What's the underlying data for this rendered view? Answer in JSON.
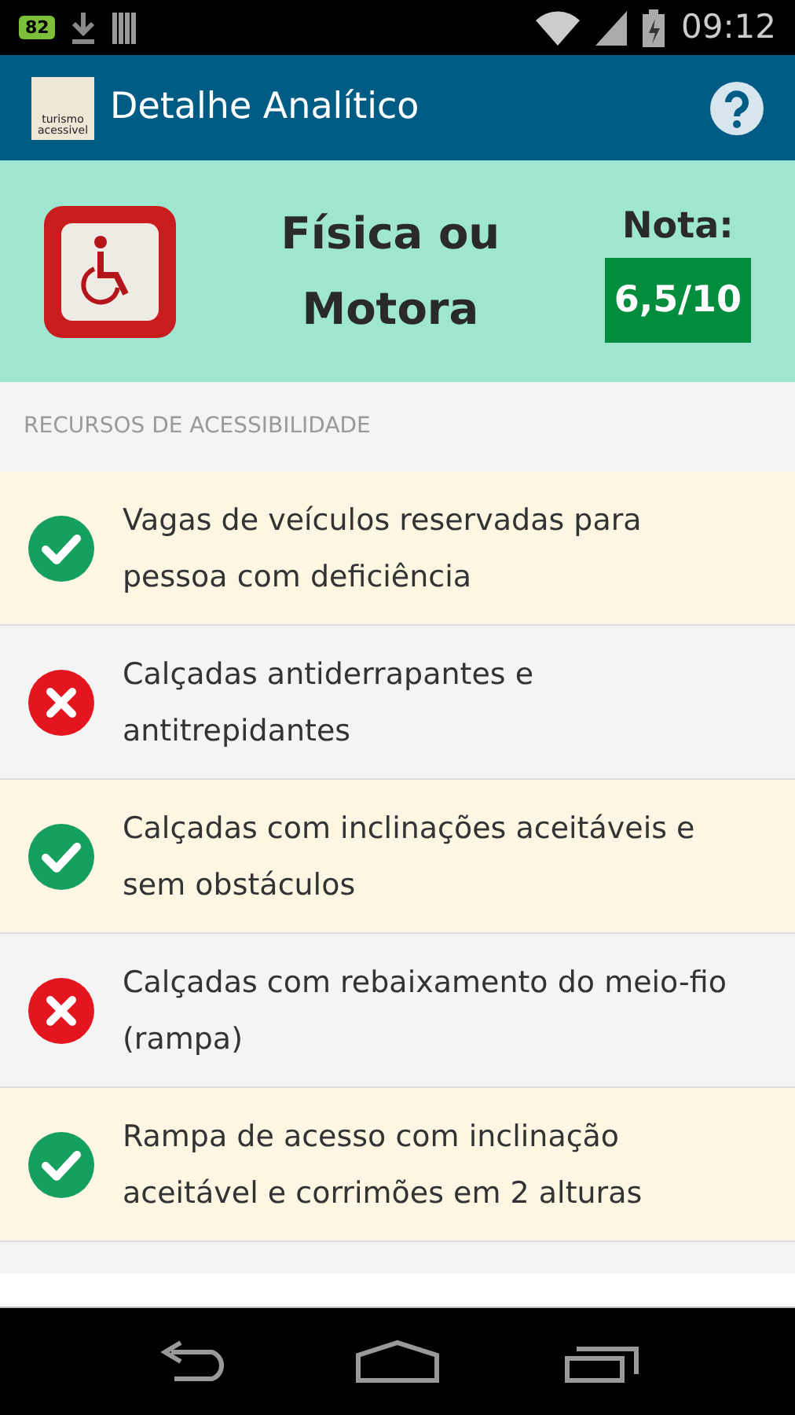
{
  "status_bar": {
    "battery_badge": "82",
    "time": "09:12"
  },
  "app_bar": {
    "logo_text": [
      "turismo",
      "acessivel"
    ],
    "title": "Detalhe Analítico"
  },
  "summary": {
    "category": "Física ou Motora",
    "score_label": "Nota:",
    "score": "6,5/10"
  },
  "section_label": "RECURSOS DE ACESSIBILIDADE",
  "resources": [
    {
      "text": "Vagas de veículos reservadas para pessoa com deficiência",
      "available": true
    },
    {
      "text": "Calçadas antiderrapantes e antitrepidantes",
      "available": false
    },
    {
      "text": "Calçadas com inclinações aceitáveis e sem obstáculos",
      "available": true
    },
    {
      "text": "Calçadas com rebaixamento do meio-fio (rampa)",
      "available": false
    },
    {
      "text": "Rampa de acesso com inclinação aceitável e corrimões em 2 alturas",
      "available": true
    }
  ]
}
